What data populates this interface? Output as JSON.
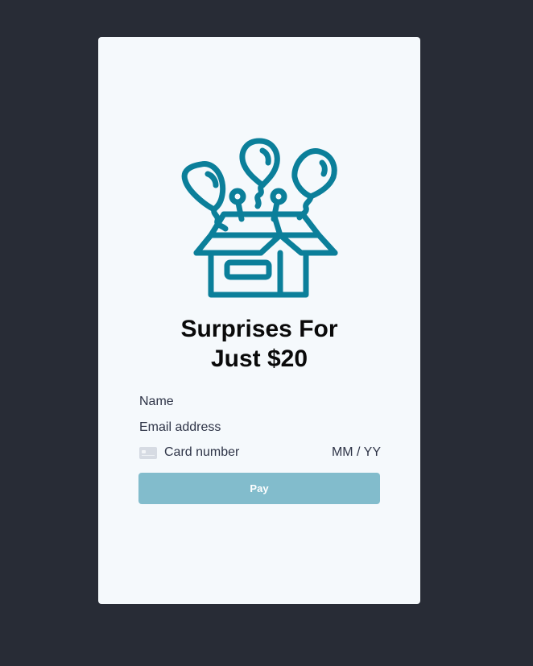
{
  "checkout": {
    "title_line1": "Surprises For",
    "title_line2": "Just $20",
    "hero_icon": "gift-box-with-balloons-icon",
    "fields": {
      "name_placeholder": "Name",
      "email_placeholder": "Email address",
      "card_number_placeholder": "Card number",
      "expiry_placeholder": "MM / YY"
    },
    "card_icon": "credit-card-icon",
    "pay_label": "Pay"
  },
  "colors": {
    "background": "#282c36",
    "card": "#f5f9fc",
    "accent": "#0b7f9a",
    "pay_button": "#82bccc",
    "text": "#2e3447"
  }
}
